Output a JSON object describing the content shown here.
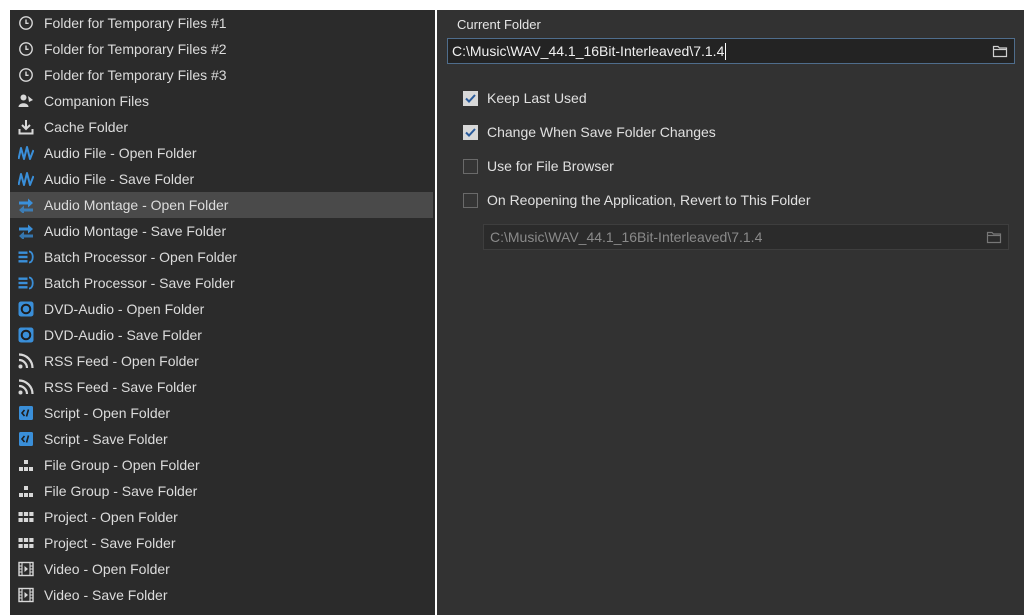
{
  "folder_list": {
    "items": [
      {
        "label": "Folder for Temporary Files #1",
        "icon": "clock-icon"
      },
      {
        "label": "Folder for Temporary Files #2",
        "icon": "clock-icon"
      },
      {
        "label": "Folder for Temporary Files #3",
        "icon": "clock-icon"
      },
      {
        "label": "Companion Files",
        "icon": "companion-icon"
      },
      {
        "label": "Cache Folder",
        "icon": "download-icon"
      },
      {
        "label": "Audio File - Open Folder",
        "icon": "waveform-icon"
      },
      {
        "label": "Audio File - Save Folder",
        "icon": "waveform-icon"
      },
      {
        "label": "Audio Montage - Open Folder",
        "icon": "montage-icon"
      },
      {
        "label": "Audio Montage - Save Folder",
        "icon": "montage-icon"
      },
      {
        "label": "Batch Processor - Open Folder",
        "icon": "batch-icon"
      },
      {
        "label": "Batch Processor - Save Folder",
        "icon": "batch-icon"
      },
      {
        "label": "DVD-Audio - Open Folder",
        "icon": "dvd-icon"
      },
      {
        "label": "DVD-Audio - Save Folder",
        "icon": "dvd-icon"
      },
      {
        "label": "RSS Feed - Open Folder",
        "icon": "rss-icon"
      },
      {
        "label": "RSS Feed - Save Folder",
        "icon": "rss-icon"
      },
      {
        "label": "Script - Open Folder",
        "icon": "script-icon"
      },
      {
        "label": "Script - Save Folder",
        "icon": "script-icon"
      },
      {
        "label": "File Group - Open Folder",
        "icon": "file-group-icon"
      },
      {
        "label": "File Group - Save Folder",
        "icon": "file-group-icon"
      },
      {
        "label": "Project - Open Folder",
        "icon": "project-icon"
      },
      {
        "label": "Project - Save Folder",
        "icon": "project-icon"
      },
      {
        "label": "Video - Open Folder",
        "icon": "video-icon"
      },
      {
        "label": "Video - Save Folder",
        "icon": "video-icon"
      }
    ],
    "selected_index": 7
  },
  "settings": {
    "current_folder_label": "Current Folder",
    "current_folder_value": "C:\\Music\\WAV_44.1_16Bit-Interleaved\\7.1.4",
    "options": [
      {
        "label": "Keep Last Used",
        "checked": true
      },
      {
        "label": "Change When Save Folder Changes",
        "checked": true
      },
      {
        "label": "Use for File Browser",
        "checked": false
      },
      {
        "label": "On Reopening the Application, Revert to This Folder",
        "checked": false
      }
    ],
    "revert_folder_value": "C:\\Music\\WAV_44.1_16Bit-Interleaved\\7.1.4"
  },
  "colors": {
    "panel_bg": "#2b2b2b",
    "selected_bg": "#4a4a4a",
    "accent_blue": "#3a8fd9",
    "field_border": "#4f6d8c"
  }
}
